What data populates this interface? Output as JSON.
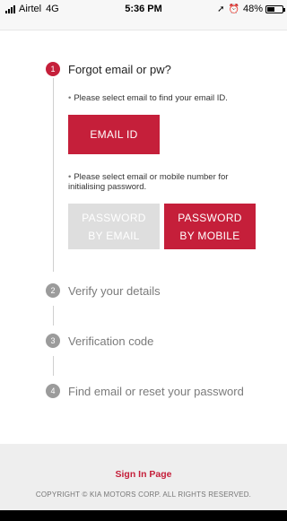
{
  "status_bar": {
    "carrier": "Airtel",
    "network": "4G",
    "time": "5:36 PM",
    "location_icon": "location-arrow-icon",
    "alarm_icon": "alarm-icon",
    "battery_percent": "48%",
    "battery_level": 0.48
  },
  "steps": [
    {
      "number": "1",
      "title": "Forgot email or pw?",
      "active": true
    },
    {
      "number": "2",
      "title": "Verify your details",
      "active": false
    },
    {
      "number": "3",
      "title": "Verification code",
      "active": false
    },
    {
      "number": "4",
      "title": "Find email or reset your password",
      "active": false
    }
  ],
  "step1": {
    "note_email": "Please select email to find your email ID.",
    "email_button": "EMAIL ID",
    "note_password": "Please select email or mobile number for initialising password.",
    "password_email_button": "PASSWORD\nBY EMAIL",
    "password_mobile_button": "PASSWORD\nBY MOBILE"
  },
  "footer": {
    "signin_link": "Sign In Page",
    "copyright": "COPYRIGHT © KIA MOTORS CORP. ALL RIGHTS RESERVED."
  },
  "colors": {
    "accent": "#c51f3a",
    "disabled": "#dedede",
    "inactive": "#9b9b9b"
  }
}
